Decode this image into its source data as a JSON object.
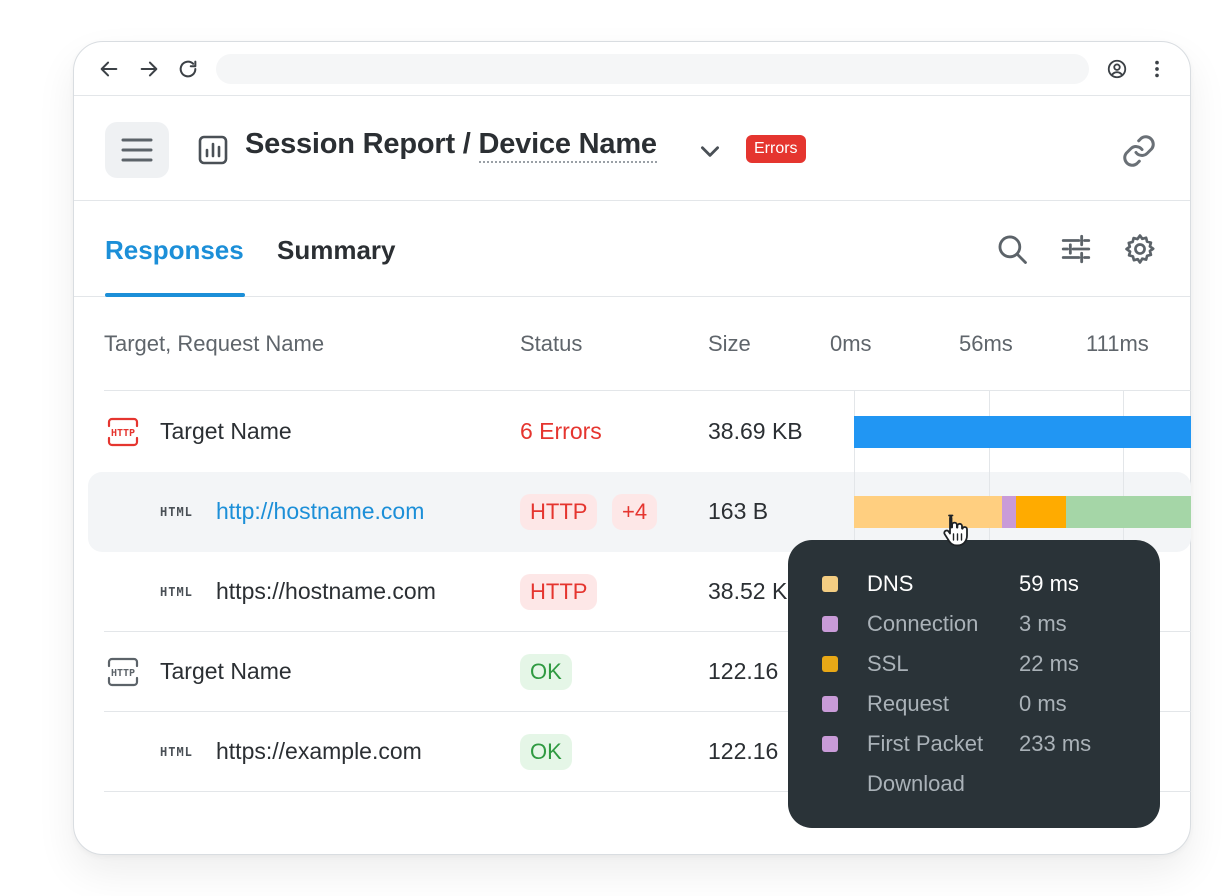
{
  "header": {
    "title_prefix": "Session Report / ",
    "device_name": "Device Name",
    "errors_badge": "Errors"
  },
  "tabs": [
    {
      "label": "Responses",
      "active": true
    },
    {
      "label": "Summary",
      "active": false
    }
  ],
  "table": {
    "columns": {
      "name": "Target, Request Name",
      "status": "Status",
      "size": "Size"
    },
    "timeline_ticks": [
      "0ms",
      "56ms",
      "111ms"
    ],
    "rows": [
      {
        "type": "target",
        "name": "Target Name",
        "status": "6 Errors",
        "size": "38.69 KB",
        "icon": "http-icon-red"
      },
      {
        "type": "request",
        "tag": "HTML",
        "name": "http://hostname.com",
        "status": "HTTP",
        "status_extra": "+4",
        "size": "163 B",
        "highlighted": true
      },
      {
        "type": "request",
        "tag": "HTML",
        "name": "https://hostname.com",
        "status": "HTTP",
        "size": "38.52 K"
      },
      {
        "type": "target",
        "name": "Target Name",
        "status": "OK",
        "size": "122.16",
        "icon": "http-icon-gray"
      },
      {
        "type": "request",
        "tag": "HTML",
        "name": "https://example.com",
        "status": "OK",
        "size": "122.16"
      }
    ]
  },
  "tooltip": {
    "items": [
      {
        "label": "DNS",
        "value": "59 ms",
        "color": "#f3cd82",
        "active": true
      },
      {
        "label": "Connection",
        "value": "3 ms",
        "color": "#c99bd8"
      },
      {
        "label": "SSL",
        "value": "22 ms",
        "color": "#e8a816"
      },
      {
        "label": "Request",
        "value": "0 ms",
        "color": "#c99bd8"
      },
      {
        "label": "First Packet",
        "value": "233 ms",
        "color": "#c99bd8"
      },
      {
        "label": "Download",
        "value": "",
        "color": ""
      }
    ]
  },
  "colors": {
    "accent": "#1c8fd8",
    "error": "#e5352f",
    "ok": "#2f9a41",
    "target_bar": "#2196f3",
    "dns": "#ffcf80",
    "connection": "#c99bd8",
    "ssl": "#ffab00",
    "download": "#a5d6a7"
  }
}
